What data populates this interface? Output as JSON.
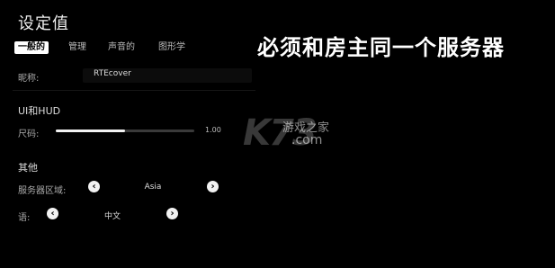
{
  "header": {
    "title": "设定值"
  },
  "tabs": [
    {
      "label": "一般的",
      "active": true
    },
    {
      "label": "管理",
      "active": false
    },
    {
      "label": "声音的",
      "active": false
    },
    {
      "label": "图形学",
      "active": false
    }
  ],
  "notice": "必须和房主同一个服务器",
  "nickname": {
    "label": "昵称:",
    "value": "RTEcover"
  },
  "ui_hud": {
    "heading": "UI和HUD",
    "size_label": "尺码:",
    "size_value": "1.00",
    "size_fraction": 0.5
  },
  "other": {
    "heading": "其他",
    "server_region": {
      "label": "服务器区域:",
      "value": "Asia"
    },
    "language": {
      "label": "语:",
      "value": "中文"
    }
  },
  "watermark": {
    "brand": "K73",
    "cn": "游戏之家",
    "domain": ".com"
  },
  "colors": {
    "background": "#000000",
    "accent": "#f2f2f2"
  }
}
